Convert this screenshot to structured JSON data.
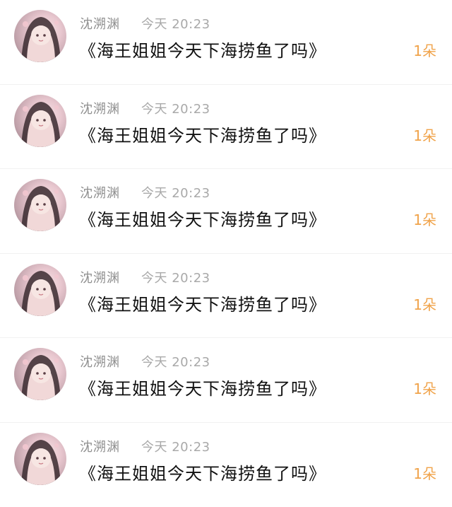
{
  "rows": [
    {
      "name": "沈溯渊",
      "time": "今天 20:23",
      "message": "《海王姐姐今天下海捞鱼了吗》",
      "count": "1朵"
    },
    {
      "name": "沈溯渊",
      "time": "今天 20:23",
      "message": "《海王姐姐今天下海捞鱼了吗》",
      "count": "1朵"
    },
    {
      "name": "沈溯渊",
      "time": "今天 20:23",
      "message": "《海王姐姐今天下海捞鱼了吗》",
      "count": "1朵"
    },
    {
      "name": "沈溯渊",
      "time": "今天 20:23",
      "message": "《海王姐姐今天下海捞鱼了吗》",
      "count": "1朵"
    },
    {
      "name": "沈溯渊",
      "time": "今天 20:23",
      "message": "《海王姐姐今天下海捞鱼了吗》",
      "count": "1朵"
    },
    {
      "name": "沈溯渊",
      "time": "今天 20:23",
      "message": "《海王姐姐今天下海捞鱼了吗》",
      "count": "1朵"
    }
  ],
  "icons": {
    "avatar": "avatar-illustration"
  },
  "colors": {
    "name": "#8f8f8f",
    "time": "#a9a9a9",
    "message": "#111111",
    "count": "#f0a34a"
  }
}
